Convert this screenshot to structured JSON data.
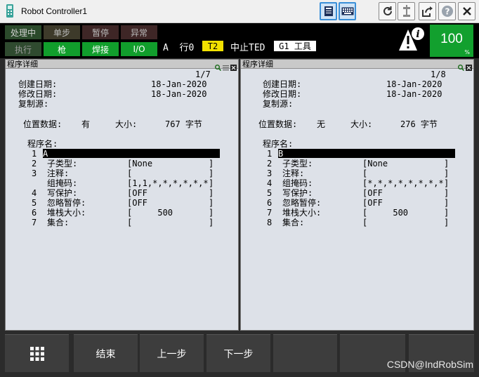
{
  "window": {
    "title": "Robot Controller1"
  },
  "status": {
    "buttons": {
      "busy": "处理中",
      "step": "单步",
      "hold": "暂停",
      "fault": "异常",
      "run": "执行",
      "gun": "枪",
      "weld": "焊接",
      "io": "I/O"
    },
    "line_text": "A  行0",
    "mode": "T2",
    "abort_text": "中止TED",
    "frame": "G1 工具",
    "speed": "100",
    "speed_unit": "%"
  },
  "panels": [
    {
      "title": "程序详细",
      "page": "1/7",
      "created_label": "创建日期:",
      "created_value": "18-Jan-2020",
      "modified_label": "修改日期:",
      "modified_value": "18-Jan-2020",
      "copy_label": "复制源:",
      "position_label": "位置数据:",
      "position_value": "有",
      "size_label": "大小:",
      "size_value": "767 字节",
      "name_label": "程序名:",
      "rows": [
        {
          "num": "1",
          "label": "A",
          "value": "",
          "close": ""
        },
        {
          "num": "2",
          "label": "子类型:",
          "value": "[None",
          "close": "]"
        },
        {
          "num": "3",
          "label": "注释:",
          "value": "[",
          "close": "]"
        },
        {
          "num": "",
          "label": "组掩码:",
          "value": "[1,1,*,*,*,*,*,*",
          "close": "]"
        },
        {
          "num": "4",
          "label": "写保护:",
          "value": "[OFF",
          "close": "]"
        },
        {
          "num": "5",
          "label": "忽略暂停:",
          "value": "[OFF",
          "close": "]"
        },
        {
          "num": "6",
          "label": "堆栈大小:",
          "value": "[     500",
          "close": "]"
        },
        {
          "num": "7",
          "label": "集合:",
          "value": "[",
          "close": "]"
        }
      ]
    },
    {
      "title": "程序详细",
      "page": "1/8",
      "created_label": "创建日期:",
      "created_value": "18-Jan-2020",
      "modified_label": "修改日期:",
      "modified_value": "18-Jan-2020",
      "copy_label": "复制源:",
      "position_label": "位置数据:",
      "position_value": "无",
      "size_label": "大小:",
      "size_value": "276 字节",
      "name_label": "程序名:",
      "rows": [
        {
          "num": "1",
          "label": "B",
          "value": "",
          "close": ""
        },
        {
          "num": "2",
          "label": "子类型:",
          "value": "[None",
          "close": "]"
        },
        {
          "num": "3",
          "label": "注释:",
          "value": "[",
          "close": "]"
        },
        {
          "num": "4",
          "label": "组掩码:",
          "value": "[*,*,*,*,*,*,*,*",
          "close": "]"
        },
        {
          "num": "5",
          "label": "写保护:",
          "value": "[OFF",
          "close": "]"
        },
        {
          "num": "6",
          "label": "忽略暂停:",
          "value": "[OFF",
          "close": "]"
        },
        {
          "num": "7",
          "label": "堆栈大小:",
          "value": "[     500",
          "close": "]"
        },
        {
          "num": "8",
          "label": "集合:",
          "value": "[",
          "close": "]"
        }
      ]
    }
  ],
  "function_keys": [
    "结束",
    "上一步",
    "下一步"
  ],
  "watermark": "CSDN@IndRobSim"
}
